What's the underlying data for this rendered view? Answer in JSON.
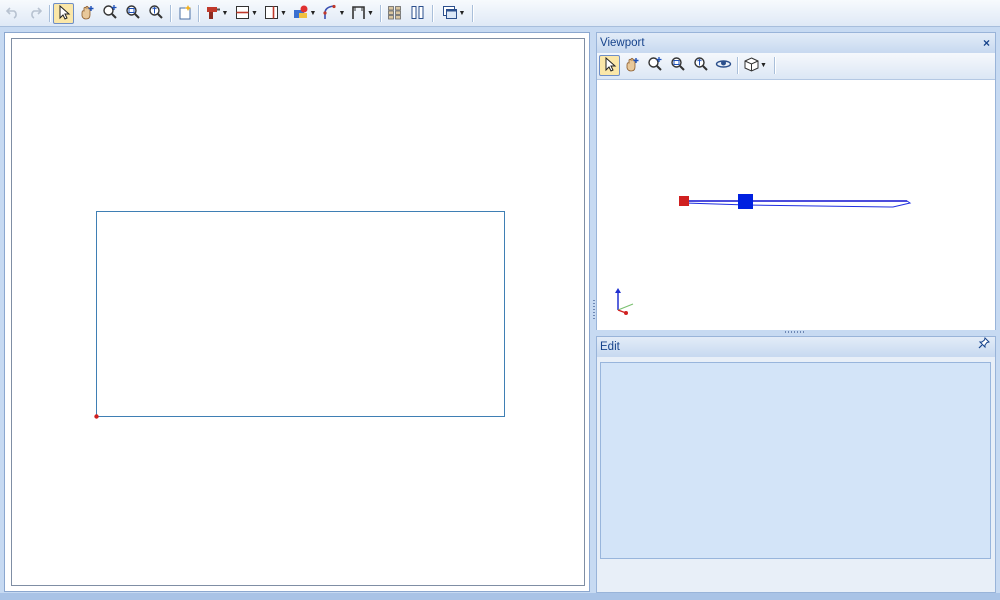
{
  "toolbar": {
    "buttons": [
      {
        "id": "undo",
        "icon": "undo-icon",
        "enabled": false
      },
      {
        "id": "redo",
        "icon": "redo-icon",
        "enabled": false
      },
      {
        "id": "select",
        "icon": "select-arrow-icon",
        "active": true
      },
      {
        "id": "pan",
        "icon": "pan-hand-icon"
      },
      {
        "id": "zoom-in",
        "icon": "zoom-in-icon"
      },
      {
        "id": "zoom-window",
        "icon": "zoom-window-icon"
      },
      {
        "id": "zoom-extents",
        "icon": "zoom-extents-icon"
      },
      {
        "id": "new-element",
        "icon": "new-element-icon"
      },
      {
        "id": "drill",
        "icon": "drill-icon",
        "dropdown": true
      },
      {
        "id": "horizontal-divider",
        "icon": "horizontal-divider-icon",
        "dropdown": true
      },
      {
        "id": "vertical-divider",
        "icon": "vertical-divider-icon",
        "dropdown": true
      },
      {
        "id": "hardware",
        "icon": "hardware-icon",
        "dropdown": true
      },
      {
        "id": "curve",
        "icon": "curve-icon",
        "dropdown": true
      },
      {
        "id": "frame",
        "icon": "frame-icon",
        "dropdown": true
      },
      {
        "id": "grid-layout",
        "icon": "grid-layout-icon"
      },
      {
        "id": "columns-layout",
        "icon": "columns-layout-icon"
      },
      {
        "id": "window-layout",
        "icon": "window-layout-icon",
        "dropdown": true
      }
    ]
  },
  "viewport": {
    "title": "Viewport",
    "close_glyph": "×",
    "tools": [
      {
        "id": "vp-select",
        "icon": "select-arrow-icon",
        "active": true
      },
      {
        "id": "vp-pan",
        "icon": "pan-hand-icon"
      },
      {
        "id": "vp-zoom-in",
        "icon": "zoom-in-icon"
      },
      {
        "id": "vp-zoom-window",
        "icon": "zoom-window-icon"
      },
      {
        "id": "vp-zoom-extents",
        "icon": "zoom-extents-icon"
      },
      {
        "id": "vp-orbit",
        "icon": "orbit-icon"
      },
      {
        "id": "vp-view-cube",
        "icon": "view-cube-icon",
        "dropdown": true
      }
    ]
  },
  "edit": {
    "title": "Edit",
    "pin_glyph": "📌"
  },
  "colors": {
    "accent": "#15428b",
    "panel_border": "#99b4d9",
    "sheet_outline": "#3f7fb4",
    "origin_marker": "#d02020",
    "model_blue": "#0020e0"
  }
}
